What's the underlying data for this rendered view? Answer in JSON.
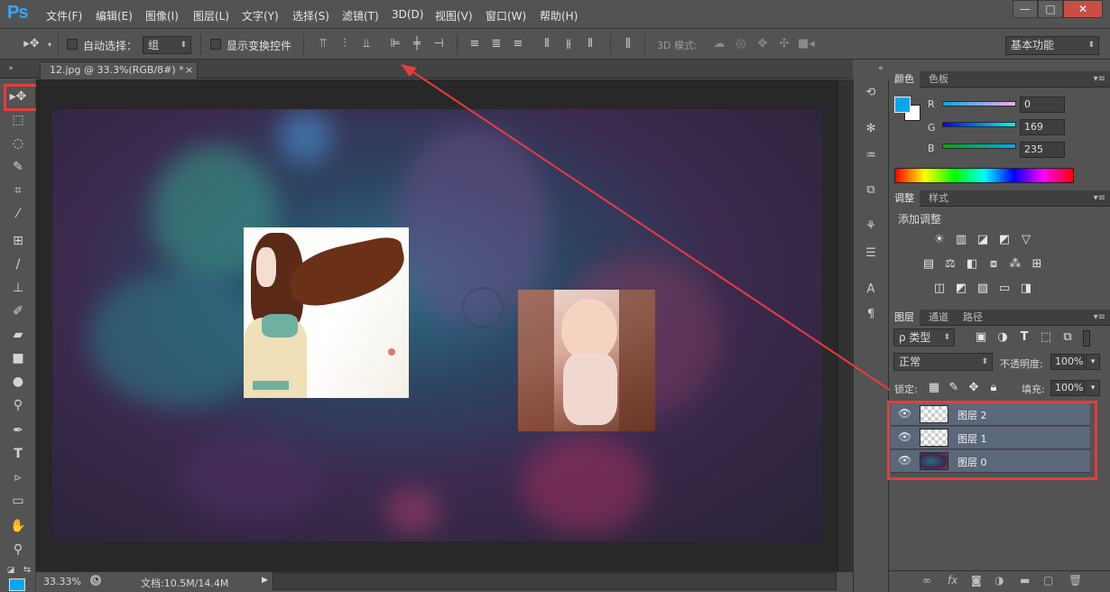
{
  "app": {
    "logo": "Ps"
  },
  "menu": [
    "文件(F)",
    "编辑(E)",
    "图像(I)",
    "图层(L)",
    "文字(Y)",
    "选择(S)",
    "滤镜(T)",
    "3D(D)",
    "视图(V)",
    "窗口(W)",
    "帮助(H)"
  ],
  "window_controls": {
    "minimize": "—",
    "restore": "□",
    "close": "✕"
  },
  "options": {
    "auto_select_label": "自动选择：",
    "auto_select_value": "组",
    "show_transform_label": "显示变换控件",
    "mode_3d_label": "3D 模式:",
    "workspace": "基本功能"
  },
  "document": {
    "tab_title": "12.jpg @ 33.3%(RGB/8#) *",
    "close": "×"
  },
  "status": {
    "zoom": "33.33%",
    "doc_info": "文档:10.5M/14.4M"
  },
  "color_panel": {
    "tabs": [
      "颜色",
      "色板"
    ],
    "r_label": "R",
    "r_value": "0",
    "g_label": "G",
    "g_value": "169",
    "b_label": "B",
    "b_value": "235",
    "foreground": "#00a9eb",
    "background": "#ffffff"
  },
  "adjust_panel": {
    "tabs": [
      "调整",
      "样式"
    ],
    "title": "添加调整"
  },
  "layers_panel": {
    "tabs": [
      "图层",
      "通道",
      "路径"
    ],
    "filter": "ρ 类型",
    "blend_mode": "正常",
    "opacity_label": "不透明度:",
    "opacity_value": "100%",
    "lock_label": "锁定:",
    "fill_label": "填充:",
    "fill_value": "100%",
    "layers": [
      {
        "name": "图层 2"
      },
      {
        "name": "图层 1"
      },
      {
        "name": "图层 0"
      }
    ]
  },
  "colors": {
    "accent": "#31a8ff",
    "highlight": "#e83c3c",
    "selected_layer": "#5b677a"
  }
}
